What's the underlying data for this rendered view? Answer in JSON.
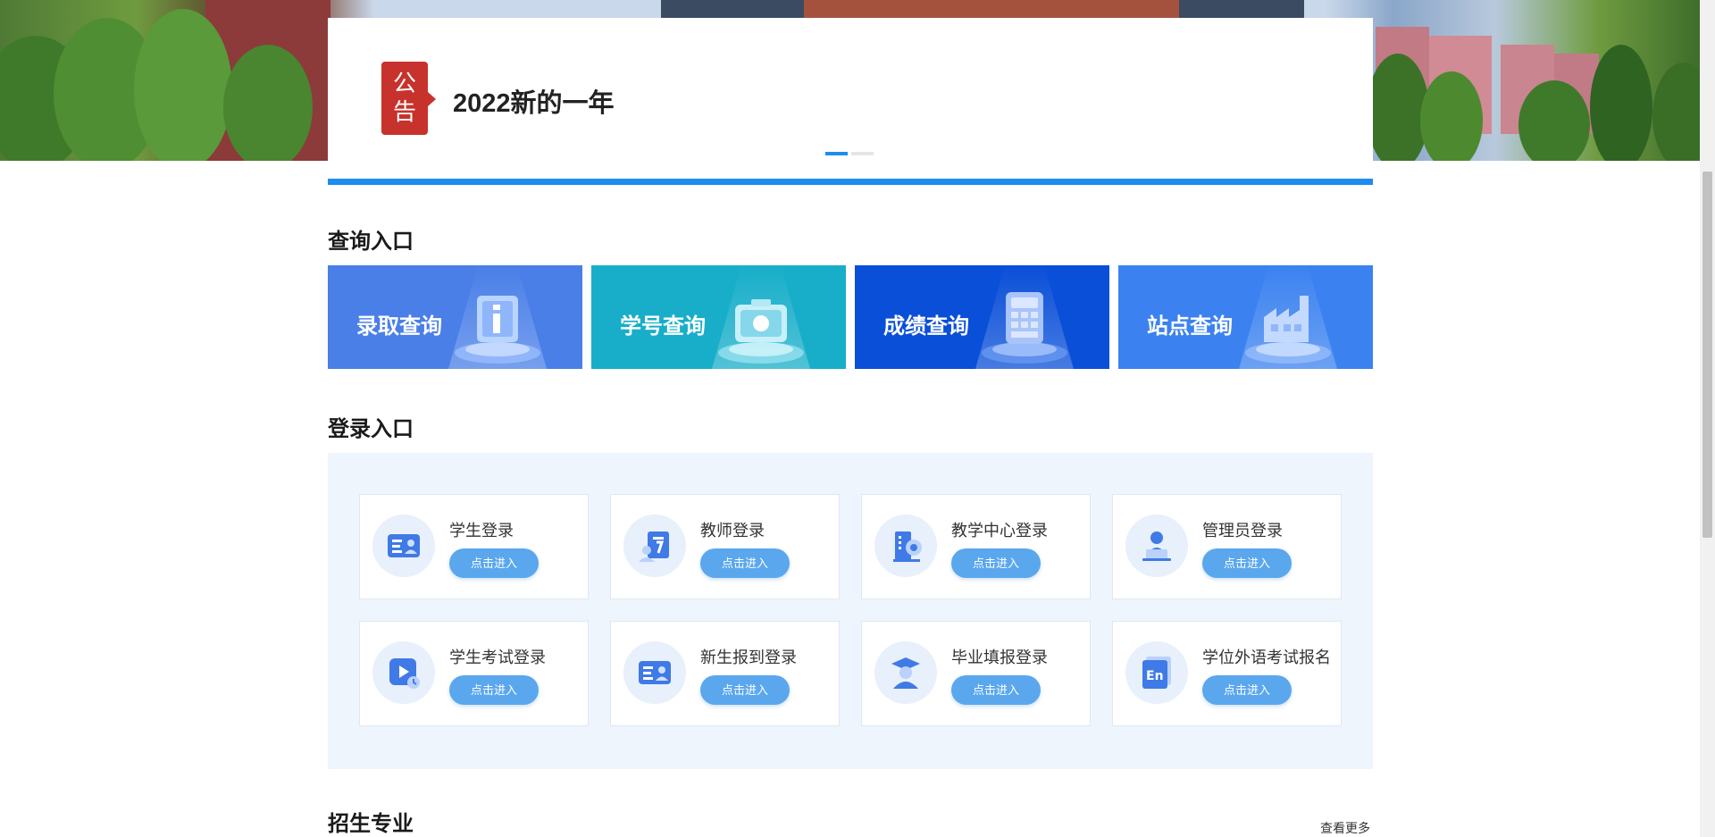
{
  "notice": {
    "badge": "公\n告",
    "badge_top": "公",
    "badge_bottom": "告",
    "title": "2022新的一年",
    "carousel_count": 2,
    "carousel_active": 0
  },
  "sections": {
    "query_title": "查询入口",
    "login_title": "登录入口",
    "major_title": "招生专业",
    "more_label": "查看更多"
  },
  "query_cards": [
    {
      "label": "录取查询",
      "color": "#4a7fe8",
      "icon": "info-icon"
    },
    {
      "label": "学号查询",
      "color": "#18aec9",
      "icon": "id-card-icon"
    },
    {
      "label": "成绩查询",
      "color": "#0a4fd8",
      "icon": "calculator-icon"
    },
    {
      "label": "站点查询",
      "color": "#3b82f0",
      "icon": "factory-icon"
    }
  ],
  "login_cards": [
    {
      "label": "学生登录",
      "button": "点击进入",
      "icon": "student-card-icon"
    },
    {
      "label": "教师登录",
      "button": "点击进入",
      "icon": "teacher-icon"
    },
    {
      "label": "教学中心登录",
      "button": "点击进入",
      "icon": "building-icon"
    },
    {
      "label": "管理员登录",
      "button": "点击进入",
      "icon": "admin-icon"
    },
    {
      "label": "学生考试登录",
      "button": "点击进入",
      "icon": "exam-play-icon"
    },
    {
      "label": "新生报到登录",
      "button": "点击进入",
      "icon": "freshman-card-icon"
    },
    {
      "label": "毕业填报登录",
      "button": "点击进入",
      "icon": "graduate-icon"
    },
    {
      "label": "学位外语考试报名",
      "button": "点击进入",
      "icon": "english-icon"
    }
  ],
  "colors": {
    "accent": "#1e8cf0",
    "notice_red": "#c8322c",
    "button_blue": "#5aa7ee",
    "panel_bg": "#eef5fc"
  }
}
